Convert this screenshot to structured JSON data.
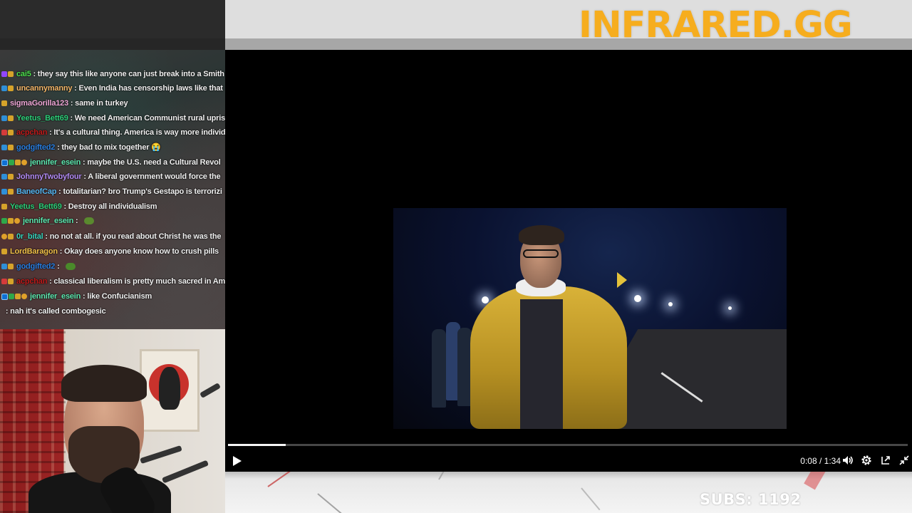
{
  "brand": {
    "logo_text": "INFRARED.GG",
    "accent": "#f6ad1e"
  },
  "chat": {
    "messages": [
      {
        "user": "cai5",
        "user_color": "#4fe34f",
        "text": " : they say this like anyone can just break into a Smith",
        "badges": [
          "b-purple",
          "b-gold"
        ]
      },
      {
        "user": "uncannymanny",
        "user_color": "#f5b86b",
        "text": " : Even India has censorship laws like that",
        "badges": [
          "b-blue",
          "b-gold"
        ]
      },
      {
        "user": "sigmaGorilla123",
        "user_color": "#f0a8d8",
        "text": " : same in turkey",
        "badges": [
          "b-gold"
        ]
      },
      {
        "user": "Yeetus_Bett69",
        "user_color": "#2ecf7a",
        "text": " : We need American Communist rural uprisin",
        "badges": [
          "b-blue",
          "b-gold"
        ]
      },
      {
        "user": "acpchan",
        "user_color": "#c11b1b",
        "text": " : It's a cultural thing. America is way more individua",
        "badges": [
          "b-red",
          "b-gold"
        ]
      },
      {
        "user": "godgifted2",
        "user_color": "#2a7fe0",
        "text": " : they bad to mix together 😭",
        "badges": [
          "b-blue",
          "b-gold"
        ]
      },
      {
        "user": "jennifer_esein",
        "user_color": "#5fe8b0",
        "text": " : maybe the U.S. need a Cultural Revol",
        "badges": [
          "b-prime",
          "b-green",
          "b-gold",
          "b-orange"
        ]
      },
      {
        "user": "JohnnyTwobyfour",
        "user_color": "#b38cf5",
        "text": " : A liberal government would force the",
        "badges": [
          "b-blue",
          "b-gold"
        ]
      },
      {
        "user": "BaneofCap",
        "user_color": "#58b7f2",
        "text": " : totalitarian? bro Trump's Gestapo is terrorizi",
        "badges": [
          "b-blue",
          "b-gold"
        ]
      },
      {
        "user": "Yeetus_Bett69",
        "user_color": "#2ecf7a",
        "text": " : Destroy all individualism",
        "badges": [
          "b-gold"
        ]
      },
      {
        "user": "jennifer_esein",
        "user_color": "#5fe8b0",
        "text": " : ",
        "badges": [
          "b-green",
          "b-gold",
          "b-orange"
        ],
        "emote": "pepe-emote-icon"
      },
      {
        "user": "0r_bital",
        "user_color": "#3ad6c0",
        "text": " : no not at all. if you read about Christ he was the",
        "badges": [
          "b-orange",
          "b-gold"
        ]
      },
      {
        "user": "LordBaragon",
        "user_color": "#f0c04a",
        "text": " : Okay does anyone know how to crush pills",
        "badges": [
          "b-gold"
        ]
      },
      {
        "user": "godgifted2",
        "user_color": "#2a7fe0",
        "text": " : ",
        "badges": [
          "b-blue",
          "b-gold"
        ],
        "emote": "turtle-emote-icon"
      },
      {
        "user": "acpchan",
        "user_color": "#c11b1b",
        "text": " : classical liberalism is pretty much sacred in Amer",
        "badges": [
          "b-red",
          "b-gold"
        ]
      },
      {
        "user": "jennifer_esein",
        "user_color": "#5fe8b0",
        "text": " : like Confucianism",
        "badges": [
          "b-prime",
          "b-green",
          "b-gold",
          "b-orange"
        ]
      },
      {
        "user": "",
        "user_color": "#ffffff",
        "text": " : nah it's called combogesic",
        "badges": []
      }
    ]
  },
  "player": {
    "time_readout": "0:08 / 1:34",
    "progress": 0.085,
    "icons": [
      "play-icon",
      "volume-icon",
      "settings-icon",
      "popout-icon",
      "collapse-icon"
    ]
  },
  "stream": {
    "subs_counter": "SUBS: 1192"
  }
}
